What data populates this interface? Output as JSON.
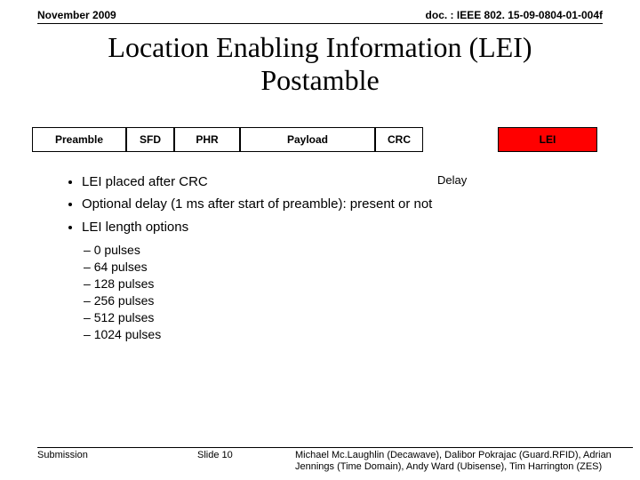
{
  "header": {
    "date": "November 2009",
    "doc_ref": "doc. : IEEE 802. 15-09-0804-01-004f"
  },
  "title_line1": "Location Enabling Information (LEI)",
  "title_line2": "Postamble",
  "packet": {
    "preamble": "Preamble",
    "sfd": "SFD",
    "phr": "PHR",
    "payload": "Payload",
    "crc": "CRC",
    "lei": "LEI"
  },
  "delay_label": "Delay",
  "bullets": [
    "LEI placed after CRC",
    "Optional delay (1 ms after start of preamble): present or not",
    "LEI length options"
  ],
  "length_options": [
    "0 pulses",
    "64 pulses",
    "128 pulses",
    "256 pulses",
    "512 pulses",
    "1024 pulses"
  ],
  "footer": {
    "left": "Submission",
    "center": "Slide 10",
    "right": "Michael Mc.Laughlin (Decawave), Dalibor Pokrajac (Guard.RFID), Adrian Jennings (Time Domain), Andy Ward (Ubisense), Tim Harrington (ZES)"
  }
}
